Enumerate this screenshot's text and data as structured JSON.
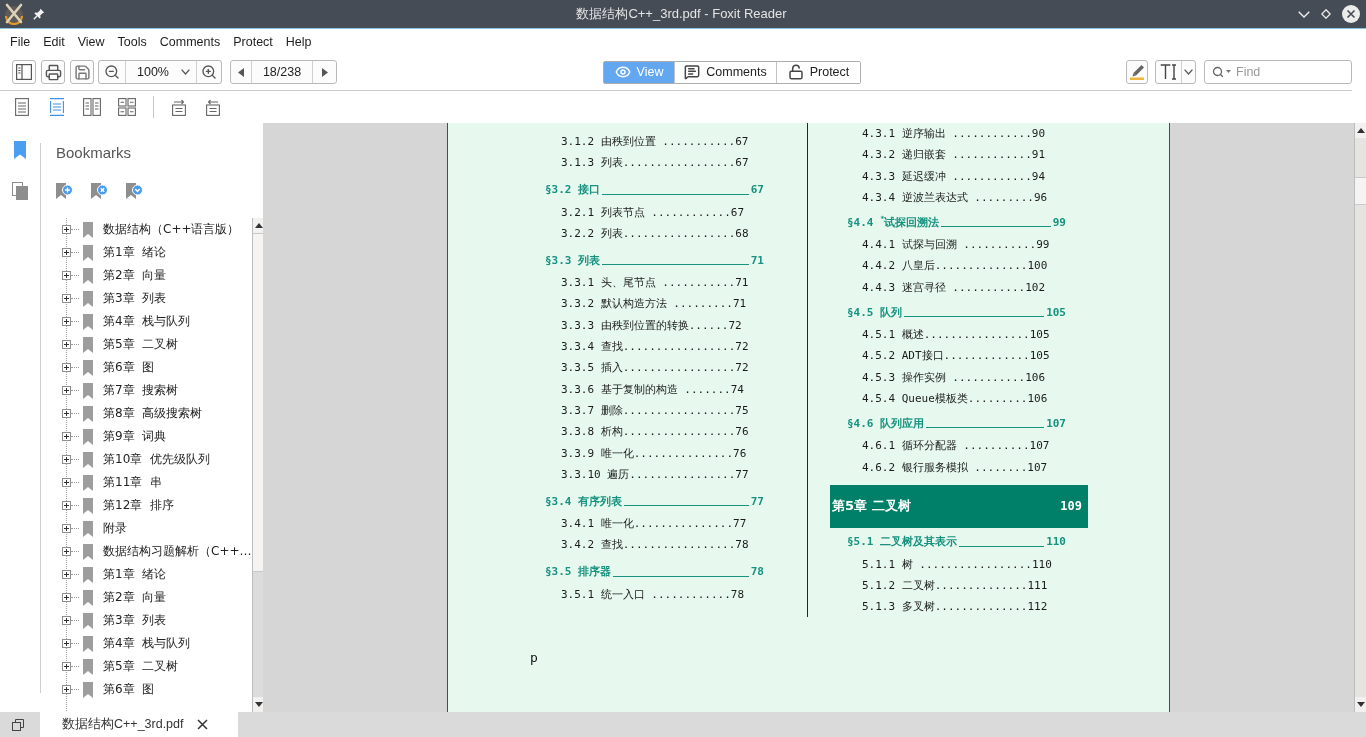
{
  "window": {
    "title": "数据结构C++_3rd.pdf - Foxit Reader"
  },
  "menu": [
    "File",
    "Edit",
    "View",
    "Tools",
    "Comments",
    "Protect",
    "Help"
  ],
  "toolbar": {
    "zoom": "100%",
    "page": "18/238",
    "modes": [
      {
        "label": "View",
        "selected": true
      },
      {
        "label": "Comments",
        "selected": false
      },
      {
        "label": "Protect",
        "selected": false
      }
    ],
    "find": {
      "placeholder": "Find"
    }
  },
  "view_modes": [
    {
      "kind": "single",
      "selected": false
    },
    {
      "kind": "continuous",
      "selected": true
    },
    {
      "kind": "facing",
      "selected": false
    },
    {
      "kind": "continuous_facing",
      "selected": false
    }
  ],
  "side_tabs": [
    {
      "kind": "bookmarks",
      "selected": true
    },
    {
      "kind": "pages",
      "selected": false
    }
  ],
  "bookmarks": {
    "title": "Bookmarks",
    "items": [
      {
        "label": "数据结构（C++语言版）",
        "expanded": false
      },
      {
        "label": "第1章  绪论",
        "expanded": false
      },
      {
        "label": "第2章  向量",
        "expanded": false
      },
      {
        "label": "第3章  列表",
        "expanded": false
      },
      {
        "label": "第4章  栈与队列",
        "expanded": false
      },
      {
        "label": "第5章  二叉树",
        "expanded": false
      },
      {
        "label": "第6章  图",
        "expanded": false
      },
      {
        "label": "第7章  搜索树",
        "expanded": false
      },
      {
        "label": "第8章  高级搜索树",
        "expanded": false
      },
      {
        "label": "第9章  词典",
        "expanded": false
      },
      {
        "label": "第10章  优先级队列",
        "expanded": false
      },
      {
        "label": "第11章  串",
        "expanded": false
      },
      {
        "label": "第12章  排序",
        "expanded": false
      },
      {
        "label": "附录",
        "expanded": false
      },
      {
        "label": "数据结构习题解析（C++…",
        "expanded": false
      },
      {
        "label": "第1章  绪论",
        "expanded": false
      },
      {
        "label": "第2章  向量",
        "expanded": false
      },
      {
        "label": "第3章  列表",
        "expanded": false
      },
      {
        "label": "第4章  栈与队列",
        "expanded": false
      },
      {
        "label": "第5章  二叉树",
        "expanded": false
      },
      {
        "label": "第6章  图",
        "expanded": false
      }
    ]
  },
  "document": {
    "left_column": [
      {
        "kind": "entry",
        "text": "3.1.2 由秩到位置 ...........67"
      },
      {
        "kind": "entry",
        "text": "3.1.3 列表.................67"
      },
      {
        "kind": "section",
        "title": "§3.2 接口",
        "page": "67"
      },
      {
        "kind": "entry",
        "text": "3.2.1 列表节点 ............67"
      },
      {
        "kind": "entry",
        "text": "3.2.2 列表.................68"
      },
      {
        "kind": "section",
        "title": "§3.3 列表",
        "page": "71"
      },
      {
        "kind": "entry",
        "text": "3.3.1 头、尾节点 ...........71"
      },
      {
        "kind": "entry",
        "text": "3.3.2 默认构造方法 .........71"
      },
      {
        "kind": "entry",
        "text": "3.3.3 由秩到位置的转换......72"
      },
      {
        "kind": "entry",
        "text": "3.3.4 查找.................72"
      },
      {
        "kind": "entry",
        "text": "3.3.5 插入.................72"
      },
      {
        "kind": "entry",
        "text": "3.3.6 基于复制的构造 .......74"
      },
      {
        "kind": "entry",
        "text": "3.3.7 删除.................75"
      },
      {
        "kind": "entry",
        "text": "3.3.8 析构.................76"
      },
      {
        "kind": "entry",
        "text": "3.3.9 唯一化...............76"
      },
      {
        "kind": "entry",
        "text": "3.3.10 遍历................77"
      },
      {
        "kind": "section",
        "title": "§3.4 有序列表",
        "page": "77"
      },
      {
        "kind": "entry",
        "text": "3.4.1 唯一化...............77"
      },
      {
        "kind": "entry",
        "text": "3.4.2 查找.................78"
      },
      {
        "kind": "section",
        "title": "§3.5 排序器",
        "page": "78"
      },
      {
        "kind": "entry",
        "text": "3.5.1 统一入口 ............78"
      }
    ],
    "right_column": [
      {
        "kind": "entry",
        "text": "4.3.1 逆序输出 ............90"
      },
      {
        "kind": "entry",
        "text": "4.3.2 递归嵌套 ............91"
      },
      {
        "kind": "entry",
        "text": "4.3.3 延迟缓冲 ............94"
      },
      {
        "kind": "entry",
        "text": "4.3.4 逆波兰表达式 .........96"
      },
      {
        "kind": "section",
        "title": "§4.4 $^{*}$试探回溯法",
        "page": "99"
      },
      {
        "kind": "entry",
        "text": "4.4.1 试探与回溯 ...........99"
      },
      {
        "kind": "entry",
        "text": "4.4.2 八皇后..............100"
      },
      {
        "kind": "entry",
        "text": "4.4.3 迷宫寻径 ...........102"
      },
      {
        "kind": "section",
        "title": "§4.5 队列",
        "page": "105"
      },
      {
        "kind": "entry",
        "text": "4.5.1 概述................105"
      },
      {
        "kind": "entry",
        "text": "4.5.2 ADT接口.............105"
      },
      {
        "kind": "entry",
        "text": "4.5.3 操作实例 ...........106"
      },
      {
        "kind": "entry",
        "text": "4.5.4 Queue模板类.........106"
      },
      {
        "kind": "section",
        "title": "§4.6 队列应用",
        "page": "107"
      },
      {
        "kind": "entry",
        "text": "4.6.1 循环分配器 ..........107"
      },
      {
        "kind": "entry",
        "text": "4.6.2 银行服务模拟 ........107"
      },
      {
        "kind": "chapter",
        "title": "第5章 二叉树",
        "page": "109"
      },
      {
        "kind": "section",
        "title": "§5.1 二叉树及其表示",
        "page": "110"
      },
      {
        "kind": "entry",
        "text": "5.1.1 树 .................110"
      },
      {
        "kind": "entry",
        "text": "5.1.2 二叉树..............111"
      },
      {
        "kind": "entry",
        "text": "5.1.3 多叉树..............112"
      }
    ],
    "footer": "p"
  },
  "tabs": [
    {
      "label": "数据结构C++_3rd.pdf",
      "selected": true
    }
  ]
}
